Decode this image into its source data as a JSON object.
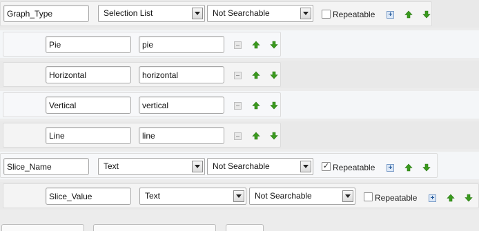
{
  "fields": [
    {
      "name": "Graph_Type",
      "type": "Selection List",
      "search": "Not Searchable",
      "repeatable_label": "Repeatable",
      "repeatable_checked": false,
      "options": [
        {
          "label": "Pie",
          "value": "pie"
        },
        {
          "label": "Horizontal",
          "value": "horizontal"
        },
        {
          "label": "Vertical",
          "value": "vertical"
        },
        {
          "label": "Line",
          "value": "line"
        }
      ]
    },
    {
      "name": "Slice_Name",
      "type": "Text",
      "search": "Not Searchable",
      "repeatable_label": "Repeatable",
      "repeatable_checked": true
    },
    {
      "name": "Slice_Value",
      "type": "Text",
      "search": "Not Searchable",
      "repeatable_label": "Repeatable",
      "repeatable_checked": false
    }
  ],
  "icons": {
    "add": "plus-icon",
    "remove": "minus-icon",
    "up": "arrow-up-icon",
    "down": "arrow-down-icon"
  },
  "colors": {
    "arrow_green": "#3a9a1e",
    "plus_blue": "#2a5c9a"
  }
}
